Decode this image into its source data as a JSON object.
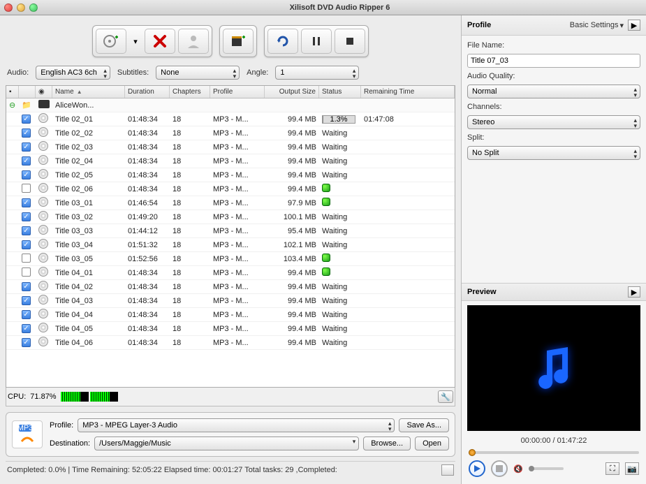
{
  "window": {
    "title": "Xilisoft DVD Audio Ripper 6"
  },
  "filters": {
    "audio_label": "Audio:",
    "audio_value": "English AC3 6ch",
    "subtitles_label": "Subtitles:",
    "subtitles_value": "None",
    "angle_label": "Angle:",
    "angle_value": "1"
  },
  "columns": {
    "name": "Name",
    "duration": "Duration",
    "chapters": "Chapters",
    "profile": "Profile",
    "output": "Output Size",
    "status": "Status",
    "remaining": "Remaining Time"
  },
  "folder": {
    "name": "AliceWon..."
  },
  "rows": [
    {
      "chk": true,
      "name": "Title 02_01",
      "duration": "01:48:34",
      "chapters": "18",
      "profile": "MP3 - M...",
      "output": "99.4 MB",
      "status_type": "progress",
      "progress": "1.3%",
      "remaining": "01:47:08"
    },
    {
      "chk": true,
      "name": "Title 02_02",
      "duration": "01:48:34",
      "chapters": "18",
      "profile": "MP3 - M...",
      "output": "99.4 MB",
      "status_type": "text",
      "status": "Waiting"
    },
    {
      "chk": true,
      "name": "Title 02_03",
      "duration": "01:48:34",
      "chapters": "18",
      "profile": "MP3 - M...",
      "output": "99.4 MB",
      "status_type": "text",
      "status": "Waiting"
    },
    {
      "chk": true,
      "name": "Title 02_04",
      "duration": "01:48:34",
      "chapters": "18",
      "profile": "MP3 - M...",
      "output": "99.4 MB",
      "status_type": "text",
      "status": "Waiting"
    },
    {
      "chk": true,
      "name": "Title 02_05",
      "duration": "01:48:34",
      "chapters": "18",
      "profile": "MP3 - M...",
      "output": "99.4 MB",
      "status_type": "text",
      "status": "Waiting"
    },
    {
      "chk": false,
      "name": "Title 02_06",
      "duration": "01:48:34",
      "chapters": "18",
      "profile": "MP3 - M...",
      "output": "99.4 MB",
      "status_type": "dot"
    },
    {
      "chk": true,
      "name": "Title 03_01",
      "duration": "01:46:54",
      "chapters": "18",
      "profile": "MP3 - M...",
      "output": "97.9 MB",
      "status_type": "dot"
    },
    {
      "chk": true,
      "name": "Title 03_02",
      "duration": "01:49:20",
      "chapters": "18",
      "profile": "MP3 - M...",
      "output": "100.1 MB",
      "status_type": "text",
      "status": "Waiting"
    },
    {
      "chk": true,
      "name": "Title 03_03",
      "duration": "01:44:12",
      "chapters": "18",
      "profile": "MP3 - M...",
      "output": "95.4 MB",
      "status_type": "text",
      "status": "Waiting"
    },
    {
      "chk": true,
      "name": "Title 03_04",
      "duration": "01:51:32",
      "chapters": "18",
      "profile": "MP3 - M...",
      "output": "102.1 MB",
      "status_type": "text",
      "status": "Waiting"
    },
    {
      "chk": false,
      "name": "Title 03_05",
      "duration": "01:52:56",
      "chapters": "18",
      "profile": "MP3 - M...",
      "output": "103.4 MB",
      "status_type": "dot"
    },
    {
      "chk": false,
      "name": "Title 04_01",
      "duration": "01:48:34",
      "chapters": "18",
      "profile": "MP3 - M...",
      "output": "99.4 MB",
      "status_type": "dot"
    },
    {
      "chk": true,
      "name": "Title 04_02",
      "duration": "01:48:34",
      "chapters": "18",
      "profile": "MP3 - M...",
      "output": "99.4 MB",
      "status_type": "text",
      "status": "Waiting"
    },
    {
      "chk": true,
      "name": "Title 04_03",
      "duration": "01:48:34",
      "chapters": "18",
      "profile": "MP3 - M...",
      "output": "99.4 MB",
      "status_type": "text",
      "status": "Waiting"
    },
    {
      "chk": true,
      "name": "Title 04_04",
      "duration": "01:48:34",
      "chapters": "18",
      "profile": "MP3 - M...",
      "output": "99.4 MB",
      "status_type": "text",
      "status": "Waiting"
    },
    {
      "chk": true,
      "name": "Title 04_05",
      "duration": "01:48:34",
      "chapters": "18",
      "profile": "MP3 - M...",
      "output": "99.4 MB",
      "status_type": "text",
      "status": "Waiting"
    },
    {
      "chk": true,
      "name": "Title 04_06",
      "duration": "01:48:34",
      "chapters": "18",
      "profile": "MP3 - M...",
      "output": "99.4 MB",
      "status_type": "text",
      "status": "Waiting"
    }
  ],
  "cpu": {
    "label": "CPU:",
    "value": "71.87%",
    "cores": [
      72,
      72
    ]
  },
  "dest": {
    "profile_label": "Profile:",
    "profile_value": "MP3 - MPEG Layer-3 Audio",
    "saveas": "Save As...",
    "destination_label": "Destination:",
    "destination_value": "/Users/Maggie/Music",
    "browse": "Browse...",
    "open": "Open"
  },
  "statusbar": {
    "text": "Completed: 0.0% | Time Remaining: 52:05:22 Elapsed time: 00:01:27 Total tasks: 29 ,Completed:"
  },
  "profile_panel": {
    "header": "Profile",
    "dropdown": "Basic Settings",
    "filename_label": "File Name:",
    "filename_value": "Title 07_03",
    "quality_label": "Audio Quality:",
    "quality_value": "Normal",
    "channels_label": "Channels:",
    "channels_value": "Stereo",
    "split_label": "Split:",
    "split_value": "No Split"
  },
  "preview": {
    "header": "Preview",
    "time": "00:00:00 / 01:47:22"
  }
}
